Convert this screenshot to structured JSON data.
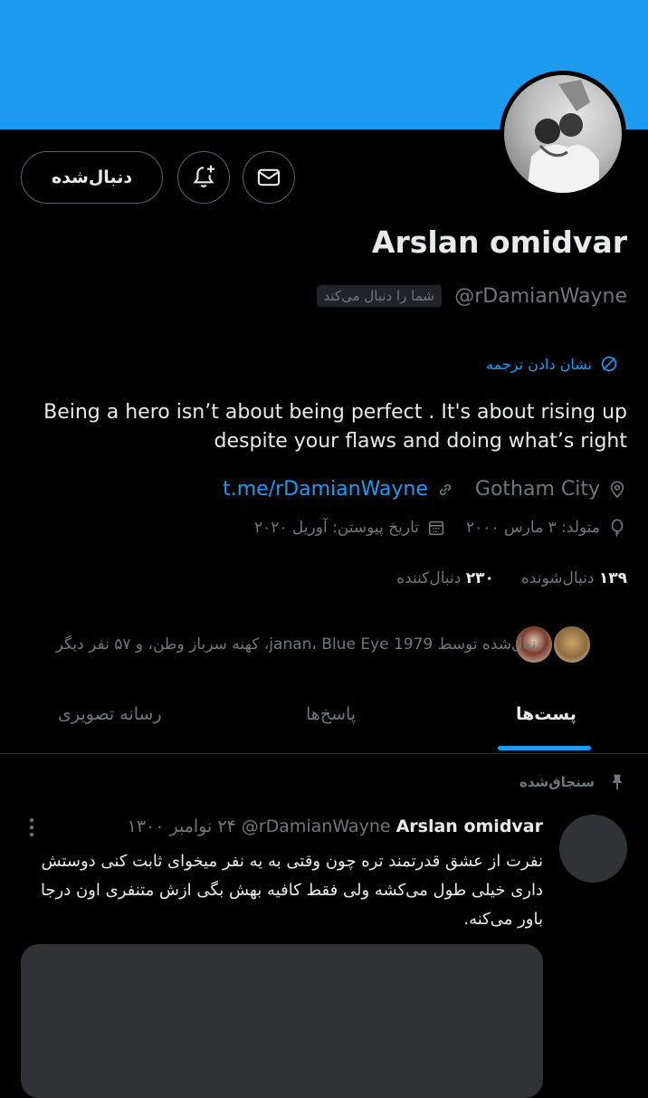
{
  "profile": {
    "name": "Arslan omidvar",
    "handle": "@rDamianWayne",
    "follows_you": "شما را دنبال می‌کند",
    "translate": "نشان دادن ترجمه",
    "bio": "Being a hero isn’t about being perfect . It's about rising up despite your flaws and doing what’s right",
    "location": "Gotham City",
    "link": "t.me/rDamianWayne",
    "born": "متولد: ۳ مارس ۲۰۰۰",
    "joined": "تاریخ پیوستن: آوریل ۲۰۲۰",
    "following_count": "۱۳۹",
    "following_label": "دنبال‌شونده",
    "followers_count": "۲۳۰",
    "followers_label": "دنبال‌کننده",
    "followed_by": "دنبال‌شده توسط janan، Blue Eye 1979، کهنه سرباز وطن، و ۵۷ نفر دیگر"
  },
  "actions": {
    "follow_label": "دنبال‌شده"
  },
  "tabs": [
    {
      "label": "پست‌ها",
      "active": true
    },
    {
      "label": "پاسخ‌ها",
      "active": false
    },
    {
      "label": "رسانه تصویری",
      "active": false
    }
  ],
  "pinned_tweet": {
    "pinned_label": "سنجاق‌شده",
    "author_name": "Arslan omidvar",
    "author_handle": "@rDamianWayne",
    "date": "۲۴ نوامبر ۱۳۰۰",
    "text": "نفرت از عشق قدرتمند تره چون وقتی به یه نفر میخوای ثابت کنی دوستش داری خیلی طول می‌کشه ولی فقط کافیه بهش بگی ازش متنفری اون درجا باور می‌کنه."
  },
  "colors": {
    "accent": "#1d9bf0",
    "background": "#000000",
    "secondary_text": "#71767b"
  }
}
